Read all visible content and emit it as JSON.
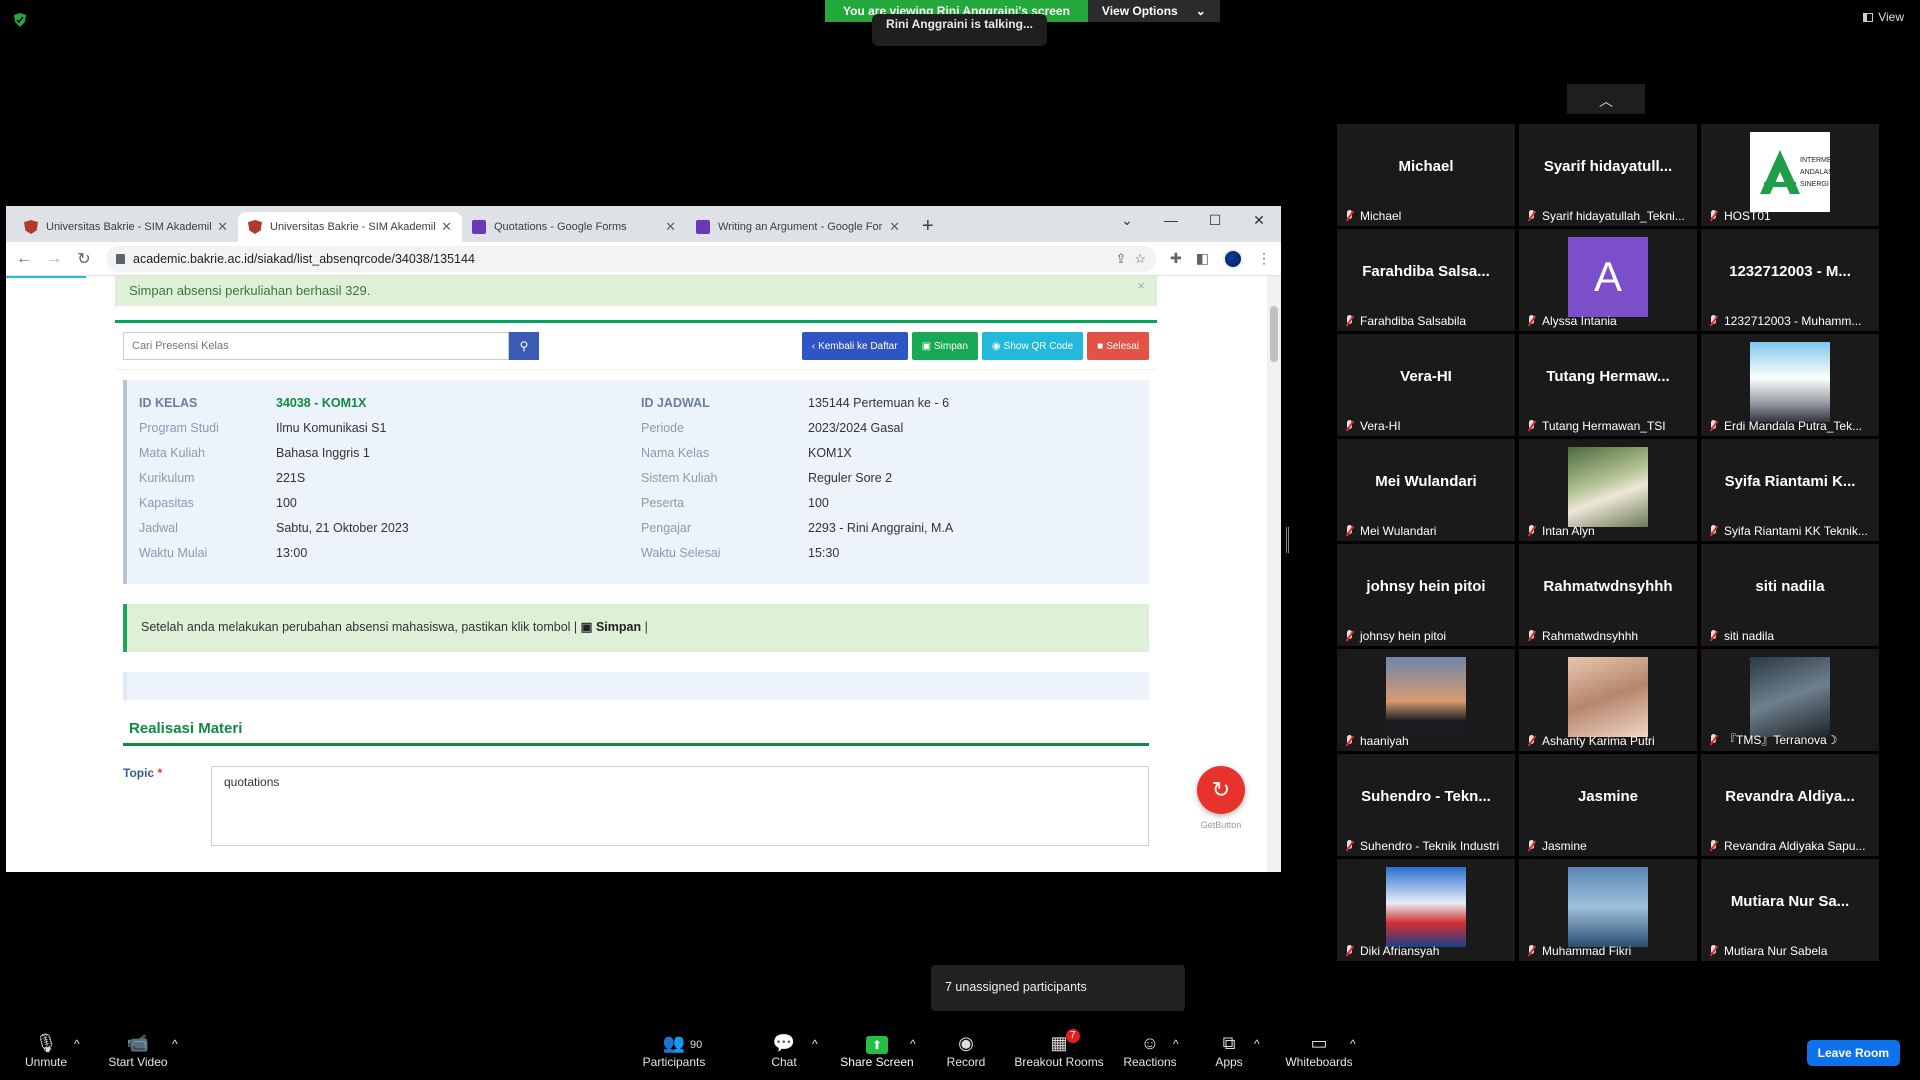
{
  "zoom": {
    "share_banner": "You are viewing Rini Anggraini's screen",
    "view_options": "View Options",
    "talking": "Rini Anggraini is talking...",
    "view_label": "View",
    "unassigned": "7 unassigned participants",
    "toolbar": {
      "unmute": "Unmute",
      "start_video": "Start Video",
      "participants": "Participants",
      "participants_count": "90",
      "chat": "Chat",
      "share_screen": "Share Screen",
      "record": "Record",
      "breakout_rooms": "Breakout Rooms",
      "breakout_badge": "7",
      "reactions": "Reactions",
      "apps": "Apps",
      "whiteboards": "Whiteboards",
      "leave": "Leave Room"
    },
    "participants": [
      {
        "display": "Michael",
        "label": "Michael",
        "type": "name"
      },
      {
        "display": "Syarif  hidayatull...",
        "label": "Syarif hidayatullah_Tekni...",
        "type": "name"
      },
      {
        "display": "",
        "label": "HOST01",
        "type": "logo",
        "logo_text": "INTERMEDIA ANDALAS SINERGI"
      },
      {
        "display": "Farahdiba  Salsa...",
        "label": "Farahdiba Salsabila",
        "type": "name"
      },
      {
        "display": "A",
        "label": "Alyssa Intania",
        "type": "avatar"
      },
      {
        "display": "1232712003 - M...",
        "label": "1232712003 - Muhamm...",
        "type": "name"
      },
      {
        "display": "Vera-HI",
        "label": "Vera-HI",
        "type": "name"
      },
      {
        "display": "Tutang  Hermaw...",
        "label": "Tutang Hermawan_TSI",
        "type": "name"
      },
      {
        "display": "",
        "label": "Erdi Mandala Putra_Tek...",
        "type": "photo1"
      },
      {
        "display": "Mei Wulandari",
        "label": "Mei Wulandari",
        "type": "name"
      },
      {
        "display": "",
        "label": "Intan Alyn",
        "type": "photo2"
      },
      {
        "display": "Syifa  Riantami  K...",
        "label": "Syifa Riantami KK Teknik...",
        "type": "name"
      },
      {
        "display": "johnsy hein pitoi",
        "label": "johnsy hein pitoi",
        "type": "name"
      },
      {
        "display": "Rahmatwdnsyhhh",
        "label": "Rahmatwdnsyhhh",
        "type": "name"
      },
      {
        "display": "siti nadila",
        "label": "siti nadila",
        "type": "name"
      },
      {
        "display": "",
        "label": "haaniyah",
        "type": "photo3"
      },
      {
        "display": "",
        "label": "Ashanty Karima Putri",
        "type": "photo4"
      },
      {
        "display": "",
        "label": "『TMS』Terranova☽",
        "type": "photo5"
      },
      {
        "display": "Suhendro  -  Tekn...",
        "label": "Suhendro - Teknik Industri",
        "type": "name"
      },
      {
        "display": "Jasmine",
        "label": "Jasmine",
        "type": "name"
      },
      {
        "display": "Revandra  Aldiya...",
        "label": "Revandra Aldiyaka Sapu...",
        "type": "name"
      },
      {
        "display": "",
        "label": "Diki Afriansyah",
        "type": "photo6"
      },
      {
        "display": "",
        "label": "Muhammad Fikri",
        "type": "photo7"
      },
      {
        "display": "Mutiara  Nur  Sa...",
        "label": "Mutiara Nur Sabela",
        "type": "name"
      }
    ]
  },
  "browser": {
    "tabs": [
      {
        "title": "Universitas Bakrie - SIM Akademik",
        "icon": "ub"
      },
      {
        "title": "Universitas Bakrie - SIM Akademik",
        "icon": "ub"
      },
      {
        "title": "Quotations - Google Forms",
        "icon": "gf"
      },
      {
        "title": "Writing an Argument - Google Forms",
        "icon": "gf"
      }
    ],
    "url": "academic.bakrie.ac.id/siakad/list_absenqrcode/34038/135144"
  },
  "page": {
    "success_msg": "Simpan absensi perkuliahan berhasil 329.",
    "search_placeholder": "Cari Presensi Kelas",
    "btn_back": "Kembali ke Daftar",
    "btn_save": "Simpan",
    "btn_qr": "Show QR Code",
    "btn_done": "Selesai",
    "left": [
      {
        "label": "ID KELAS",
        "value": "34038 - KOM1X"
      },
      {
        "label": "Program Studi",
        "value": "Ilmu Komunikasi S1"
      },
      {
        "label": "Mata Kuliah",
        "value": "Bahasa Inggris 1"
      },
      {
        "label": "Kurikulum",
        "value": "221S"
      },
      {
        "label": "Kapasitas",
        "value": "100"
      },
      {
        "label": "Jadwal",
        "value": "Sabtu, 21 Oktober 2023"
      },
      {
        "label": "Waktu Mulai",
        "value": "13:00"
      }
    ],
    "right": [
      {
        "label": "ID JADWAL",
        "value": "135144 Pertemuan ke - 6"
      },
      {
        "label": "Periode",
        "value": "2023/2024 Gasal"
      },
      {
        "label": "Nama Kelas",
        "value": "KOM1X"
      },
      {
        "label": "Sistem Kuliah",
        "value": "Reguler Sore 2"
      },
      {
        "label": "Peserta",
        "value": "100"
      },
      {
        "label": "Pengajar",
        "value": "2293 - Rini Anggraini, M.A"
      },
      {
        "label": "Waktu Selesai",
        "value": "15:30"
      }
    ],
    "note_prefix": "Setelah anda melakukan perubahan absensi mahasiswa, pastikan klik tombol |",
    "note_button": "Simpan",
    "note_suffix": "|",
    "section_title": "Realisasi Materi",
    "topic_label": "Topic",
    "topic_required": "*",
    "topic_value": "quotations",
    "getbutton_label": "GetButton"
  }
}
